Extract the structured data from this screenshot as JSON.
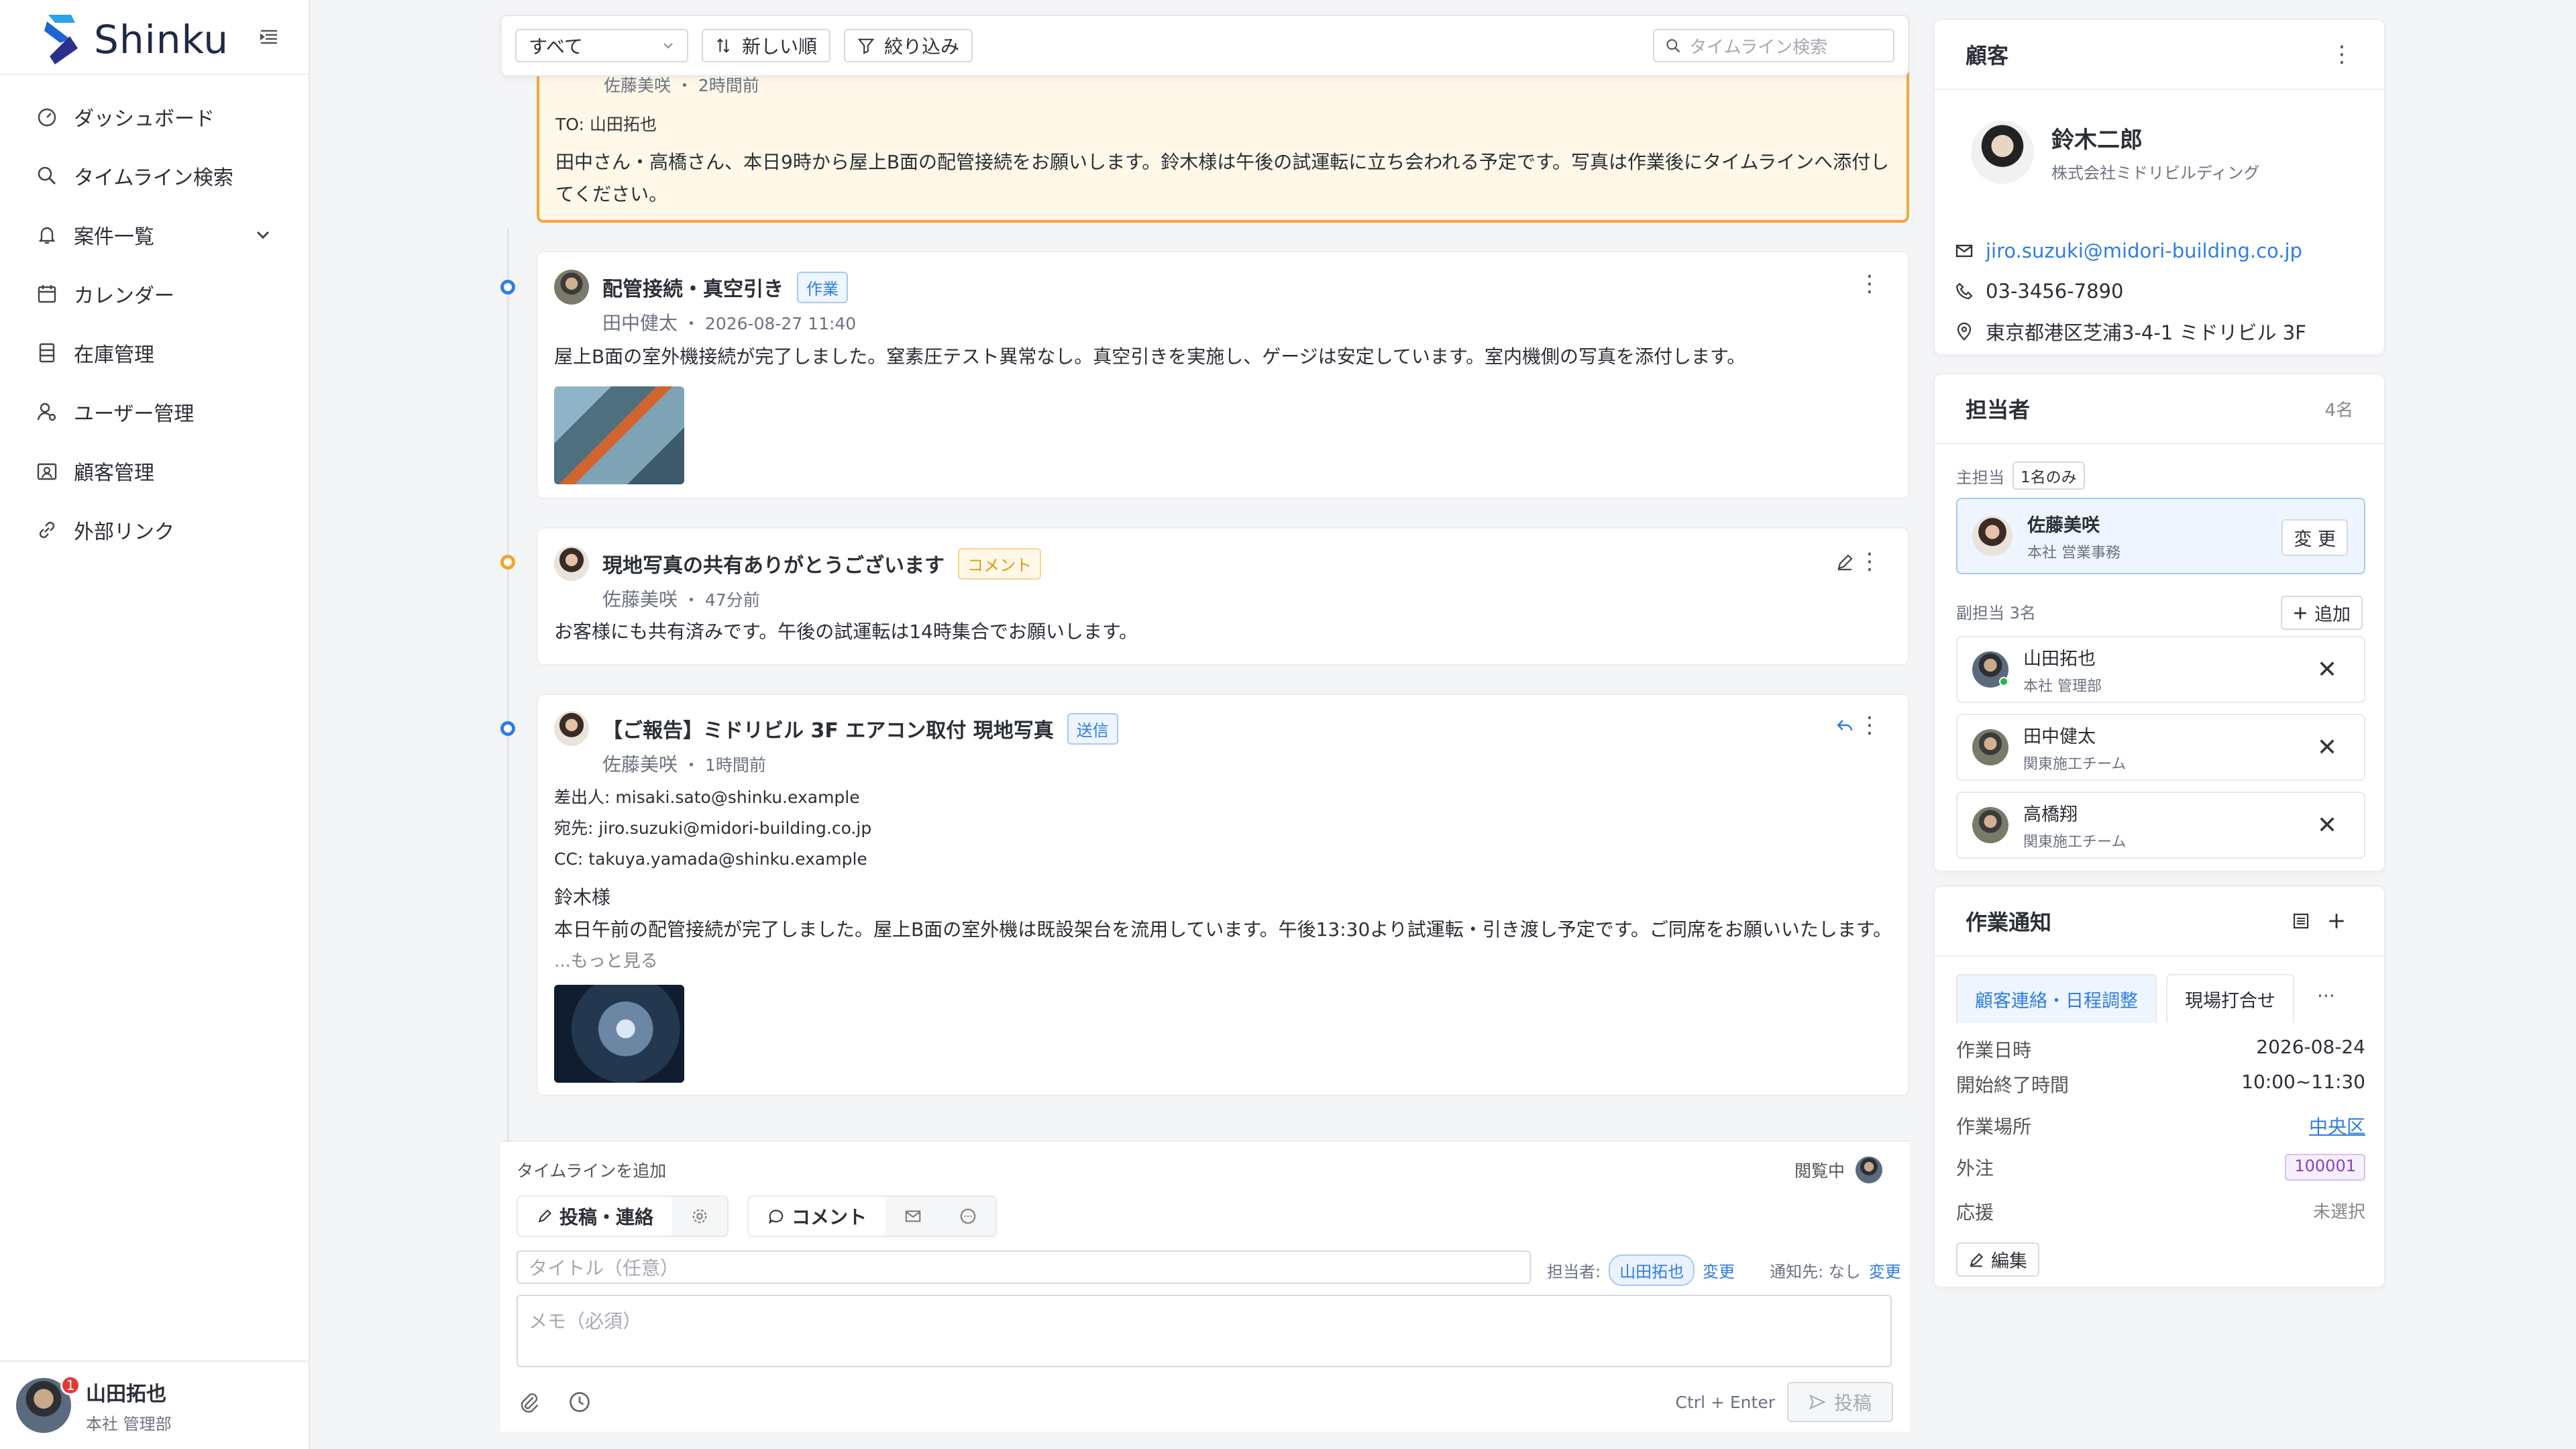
{
  "app": {
    "name": "Shinku"
  },
  "nav": [
    {
      "label": "ダッシュボード",
      "icon": "dashboard-icon"
    },
    {
      "label": "タイムライン検索",
      "icon": "search-icon"
    },
    {
      "label": "案件一覧",
      "icon": "bell-icon"
    },
    {
      "label": "カレンダー",
      "icon": "calendar-icon"
    },
    {
      "label": "在庫管理",
      "icon": "inventory-icon"
    },
    {
      "label": "ユーザー管理",
      "icon": "user-manage-icon"
    },
    {
      "label": "顧客管理",
      "icon": "customer-icon"
    },
    {
      "label": "外部リンク",
      "icon": "link-icon"
    }
  ],
  "user": {
    "name": "山田拓也",
    "role": "本社 管理部",
    "notifications": "1"
  },
  "toolbar": {
    "filter_value": "すべて",
    "sort_label": "新しい順",
    "filter_label": "絞り込み",
    "search_placeholder": "タイムライン検索"
  },
  "timeline": {
    "top_card": {
      "author_meta": "佐藤美咲 ・ 2時間前",
      "to": "TO: 山田拓也",
      "body": "田中さん・高橋さん、本日9時から屋上B面の配管接続をお願いします。鈴木様は午後の試運転に立ち会われる予定です。写真は作業後にタイムラインへ添付してください。"
    },
    "card1": {
      "title": "配管接続・真空引き",
      "badge": "作業",
      "author": "田中健太",
      "time": "2026-08-27 11:40",
      "body": "屋上B面の室外機接続が完了しました。窒素圧テスト異常なし。真空引きを実施し、ゲージは安定しています。室内機側の写真を添付します。"
    },
    "card2": {
      "title": "現地写真の共有ありがとうございます",
      "badge": "コメント",
      "author": "佐藤美咲",
      "time": "47分前",
      "body": "お客様にも共有済みです。午後の試運転は14時集合でお願いします。"
    },
    "card3": {
      "title": "【ご報告】ミドリビル 3F エアコン取付 現地写真",
      "badge": "送信",
      "author": "佐藤美咲",
      "time": "1時間前",
      "from_label": "差出人:",
      "from": "misaki.sato@shinku.example",
      "to_label": "宛先:",
      "to": "jiro.suzuki@midori-building.co.jp",
      "cc_label": "CC:",
      "cc": "takuya.yamada@shinku.example",
      "greeting": "鈴木様",
      "body": "本日午前の配管接続が完了しました。屋上B面の室外機は既設架台を流用しています。午後13:30より試運転・引き渡し予定です。ご同席をお願いいたします。",
      "more": "...もっと見る"
    }
  },
  "compose": {
    "label": "タイムラインを追加",
    "viewing": "閲覧中",
    "tab_post": "投稿・連絡",
    "tab_comment": "コメント",
    "title_placeholder": "タイトル（任意）",
    "assignee_label": "担当者:",
    "assignee": "山田拓也",
    "change": "変更",
    "notify_label": "通知先: なし",
    "memo_placeholder": "メモ（必須）",
    "shortcut": "Ctrl + Enter",
    "post": "投稿"
  },
  "customer": {
    "heading": "顧客",
    "name": "鈴木二郎",
    "company": "株式会社ミドリビルディング",
    "email": "jiro.suzuki@midori-building.co.jp",
    "phone": "03-3456-7890",
    "address": "東京都港区芝浦3-4-1 ミドリビル 3F"
  },
  "staff": {
    "heading": "担当者",
    "count": "4名",
    "main_label": "主担当",
    "main_badge": "1名のみ",
    "main": {
      "name": "佐藤美咲",
      "role": "本社 営業事務",
      "change": "変 更"
    },
    "sub_label": "副担当 3名",
    "add": "追加",
    "subs": [
      {
        "name": "山田拓也",
        "role": "本社 管理部"
      },
      {
        "name": "田中健太",
        "role": "関東施工チーム"
      },
      {
        "name": "高橋翔",
        "role": "関東施工チーム"
      }
    ]
  },
  "work": {
    "heading": "作業通知",
    "tab1": "顧客連絡・日程調整",
    "tab2": "現場打合せ",
    "rows": [
      {
        "k": "作業日時",
        "v": "2026-08-24"
      },
      {
        "k": "開始終了時間",
        "v": "10:00~11:30"
      },
      {
        "k": "作業場所",
        "v": "中央区"
      },
      {
        "k": "外注",
        "v": "100001"
      },
      {
        "k": "応援",
        "v": "未選択"
      }
    ],
    "edit": "編集"
  },
  "colors": {
    "accent": "#2f7de1",
    "highlight": "#f0a93b"
  }
}
